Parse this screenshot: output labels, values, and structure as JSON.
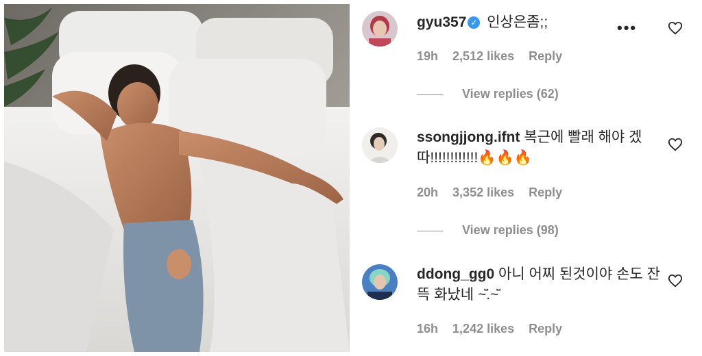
{
  "post_image": {
    "description_icon": "photo"
  },
  "comments": [
    {
      "username": "gyu357",
      "verified": true,
      "text": "인상은좀;;",
      "time": "19h",
      "likes": "2,512 likes",
      "reply_label": "Reply",
      "view_replies": "View replies (62)",
      "has_more_menu": true
    },
    {
      "username": "ssongjjong.ifnt",
      "verified": false,
      "text": "복근에 빨래 해야 겠따!!!!!!!!!!!!",
      "emoji": "🔥🔥🔥",
      "time": "20h",
      "likes": "3,352 likes",
      "reply_label": "Reply",
      "view_replies": "View replies (98)"
    },
    {
      "username": "ddong_gg0",
      "verified": false,
      "text": "아니 어찌 된것이야 손도 잔뜩 화났네 ~̆̈.~̆̈",
      "time": "16h",
      "likes": "1,242 likes",
      "reply_label": "Reply"
    }
  ],
  "icons": {
    "like": "heart-icon",
    "more": "more-options-icon",
    "verified": "verified-badge-icon"
  },
  "colors": {
    "verified": "#3897f0",
    "meta": "#8e8e8e",
    "text": "#262626"
  }
}
